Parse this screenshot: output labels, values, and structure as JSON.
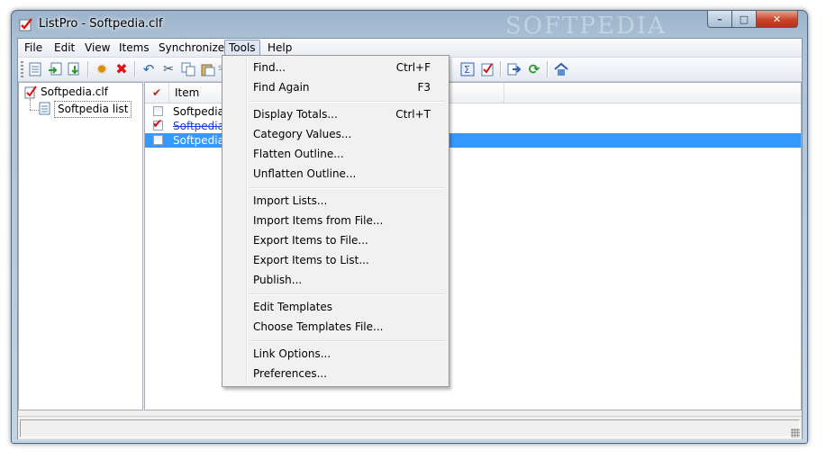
{
  "window": {
    "title": "ListPro - Softpedia.clf",
    "watermark": "SOFTPEDIA",
    "controls": {
      "minimize": "–",
      "maximize": "□",
      "close": "✕"
    }
  },
  "menubar": {
    "items": [
      "File",
      "Edit",
      "View",
      "Items",
      "Synchronize",
      "Tools",
      "Help"
    ],
    "open_menu": "Tools"
  },
  "toolbar": {
    "icons": [
      "new-list-icon",
      "import-icon",
      "export-icon",
      "settings-icon",
      "delete-icon",
      "undo-icon",
      "cut-icon",
      "copy-icon",
      "paste-icon",
      "totals-icon",
      "checklist-icon",
      "forward-icon",
      "sync-icon",
      "home-icon"
    ],
    "overlay_text": "softpedia"
  },
  "tree": {
    "root": "Softpedia.clf",
    "child": "Softpedia list"
  },
  "list": {
    "header": {
      "check": "✔",
      "item": "Item"
    },
    "rows": [
      {
        "text": "Softpedia",
        "checked": false,
        "struck": false,
        "selected": false
      },
      {
        "text": "Softpedia",
        "checked": true,
        "struck": true,
        "selected": false
      },
      {
        "text": "Softpedia",
        "checked": false,
        "struck": false,
        "selected": true
      }
    ]
  },
  "tools_menu": {
    "groups": [
      [
        {
          "label": "Find...",
          "shortcut": "Ctrl+F"
        },
        {
          "label": "Find Again",
          "shortcut": "F3"
        }
      ],
      [
        {
          "label": "Display Totals...",
          "shortcut": "Ctrl+T"
        },
        {
          "label": "Category Values...",
          "shortcut": ""
        },
        {
          "label": "Flatten Outline...",
          "shortcut": ""
        },
        {
          "label": "Unflatten Outline...",
          "shortcut": ""
        }
      ],
      [
        {
          "label": "Import Lists...",
          "shortcut": ""
        },
        {
          "label": "Import Items from File...",
          "shortcut": ""
        },
        {
          "label": "Export Items to File...",
          "shortcut": ""
        },
        {
          "label": "Export Items to List...",
          "shortcut": ""
        },
        {
          "label": "Publish...",
          "shortcut": ""
        }
      ],
      [
        {
          "label": "Edit Templates",
          "shortcut": ""
        },
        {
          "label": "Choose Templates File...",
          "shortcut": ""
        }
      ],
      [
        {
          "label": "Link Options...",
          "shortcut": ""
        },
        {
          "label": "Preferences...",
          "shortcut": ""
        }
      ]
    ]
  },
  "colors": {
    "selection": "#3399ff",
    "check_mark": "#dd1111",
    "struck_text": "#1a3fd6"
  }
}
